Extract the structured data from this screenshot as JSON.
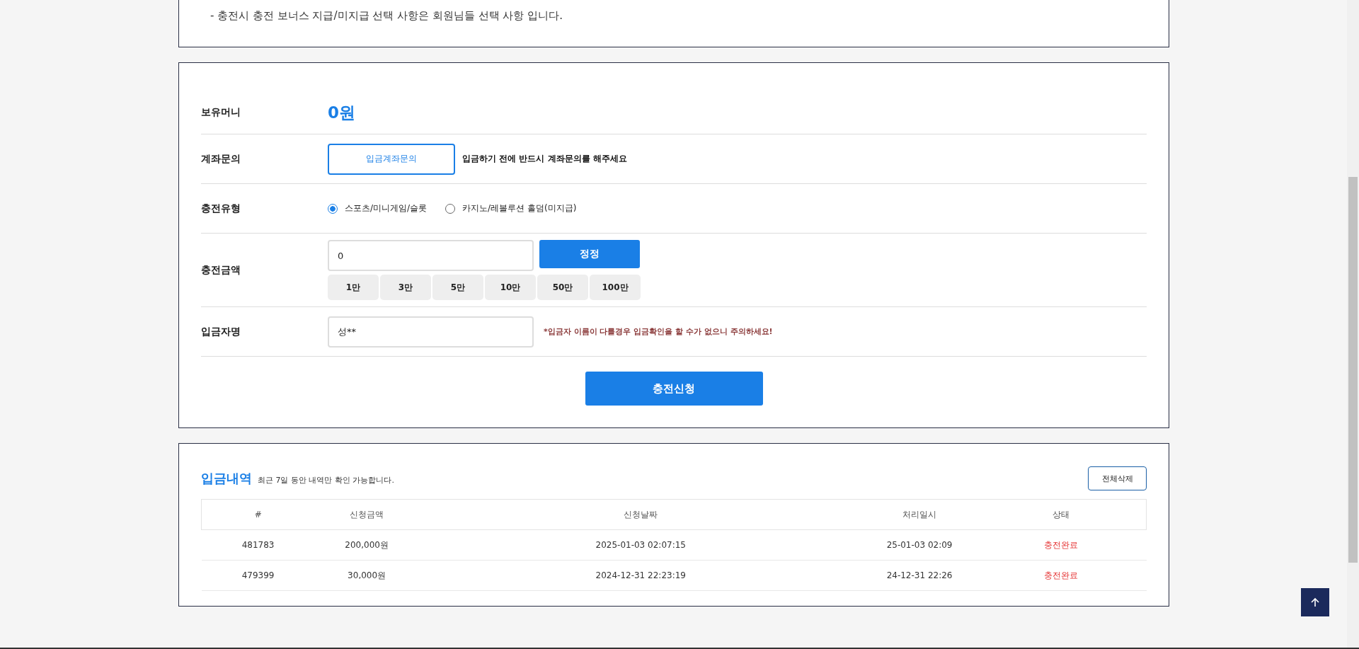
{
  "notice": {
    "text": "- 충전시 충전 보너스 지급/미지급 선택 사항은 회원님들 선택 사항 입니다."
  },
  "form": {
    "balance": {
      "label": "보유머니",
      "value": "0원"
    },
    "account": {
      "label": "계좌문의",
      "button": "입금계좌문의",
      "note": "입금하기 전에 반드시 계좌문의를 해주세요"
    },
    "type": {
      "label": "충전유형",
      "options": [
        {
          "label": "스포츠/미니게임/슬롯",
          "selected": true
        },
        {
          "label": "카지노/레볼루션 홀덤(미지급)",
          "selected": false
        }
      ]
    },
    "amount": {
      "label": "충전금액",
      "value": "0",
      "reset_button": "정정",
      "presets": [
        "1만",
        "3만",
        "5만",
        "10만",
        "50만",
        "100만"
      ]
    },
    "depositor": {
      "label": "입금자명",
      "value": "성**",
      "warning": "*입금자 이름이 다를경우 입금확인을 할 수가 없으니 주의하세요!"
    },
    "submit": "충전신청"
  },
  "history": {
    "title": "입금내역",
    "subtitle": "최근 7일 동안 내역만 확인 가능합니다.",
    "delete_all": "전체삭제",
    "columns": [
      "#",
      "신청금액",
      "신청날짜",
      "처리일시",
      "상태"
    ],
    "rows": [
      {
        "id": "481783",
        "amount": "200,000원",
        "requested": "2025-01-03 02:07:15",
        "processed": "25-01-03 02:09",
        "status": "충전완료"
      },
      {
        "id": "479399",
        "amount": "30,000원",
        "requested": "2024-12-31 22:23:19",
        "processed": "24-12-31 22:26",
        "status": "충전완료"
      }
    ]
  }
}
